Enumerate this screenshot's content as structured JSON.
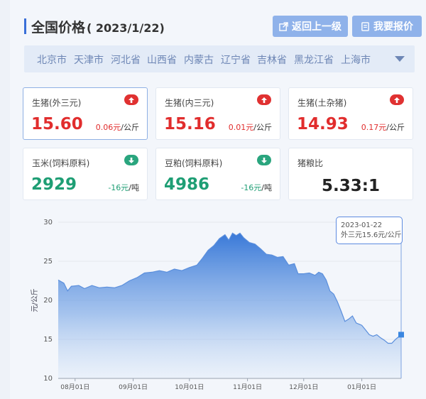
{
  "header": {
    "title": "全国价格",
    "date": "( 2023/1/22)",
    "back_label": "返回上一级",
    "quote_label": "我要报价"
  },
  "regions": [
    "北京市",
    "天津市",
    "河北省",
    "山西省",
    "内蒙古",
    "辽宁省",
    "吉林省",
    "黑龙江省",
    "上海市"
  ],
  "cards": [
    {
      "name": "生猪(外三元)",
      "price": "15.60",
      "change": "0.06元/公斤",
      "trend": "up"
    },
    {
      "name": "生猪(内三元)",
      "price": "15.16",
      "change": "0.01元/公斤",
      "trend": "up"
    },
    {
      "name": "生猪(土杂猪)",
      "price": "14.93",
      "change": "0.17元/公斤",
      "trend": "up"
    },
    {
      "name": "玉米(饲料原料)",
      "price": "2929",
      "change": "-16元/吨",
      "trend": "down"
    },
    {
      "name": "豆粕(饲料原料)",
      "price": "4986",
      "change": "-16元/吨",
      "trend": "down"
    },
    {
      "name": "猪粮比",
      "price": "5.33:1",
      "change": "",
      "trend": "none"
    }
  ],
  "colors": {
    "up": "#e12d2d",
    "down": "#1e9e74",
    "accent": "#3a6fd8",
    "line": "#4f86db"
  },
  "chart_data": {
    "type": "area",
    "ylabel": "元/公斤",
    "ylim": [
      10,
      30
    ],
    "yticks": [
      10,
      15,
      20,
      25,
      30
    ],
    "xtick_labels": [
      "08月01日",
      "09月01日",
      "10月01日",
      "11月01日",
      "12月01日",
      "01月01日"
    ],
    "xtick_dates": [
      "2022-08-01",
      "2022-09-01",
      "2022-10-01",
      "2022-11-01",
      "2022-12-01",
      "2023-01-01"
    ],
    "x_range": [
      "2022-07-23",
      "2023-01-22"
    ],
    "points": [
      [
        "2022-07-23",
        22.6
      ],
      [
        "2022-07-26",
        22.2
      ],
      [
        "2022-07-28",
        21.2
      ],
      [
        "2022-07-30",
        21.8
      ],
      [
        "2022-08-03",
        21.9
      ],
      [
        "2022-08-06",
        21.5
      ],
      [
        "2022-08-10",
        21.9
      ],
      [
        "2022-08-14",
        21.6
      ],
      [
        "2022-08-18",
        21.7
      ],
      [
        "2022-08-22",
        21.6
      ],
      [
        "2022-08-26",
        21.9
      ],
      [
        "2022-08-30",
        22.5
      ],
      [
        "2022-09-03",
        22.9
      ],
      [
        "2022-09-07",
        23.5
      ],
      [
        "2022-09-11",
        23.6
      ],
      [
        "2022-09-15",
        23.8
      ],
      [
        "2022-09-19",
        23.6
      ],
      [
        "2022-09-23",
        24.0
      ],
      [
        "2022-09-27",
        23.8
      ],
      [
        "2022-10-01",
        24.2
      ],
      [
        "2022-10-05",
        24.5
      ],
      [
        "2022-10-08",
        25.4
      ],
      [
        "2022-10-11",
        26.4
      ],
      [
        "2022-10-14",
        27.0
      ],
      [
        "2022-10-17",
        27.9
      ],
      [
        "2022-10-20",
        28.4
      ],
      [
        "2022-10-22",
        27.7
      ],
      [
        "2022-10-24",
        28.6
      ],
      [
        "2022-10-26",
        28.3
      ],
      [
        "2022-10-28",
        28.6
      ],
      [
        "2022-10-30",
        28.0
      ],
      [
        "2022-11-02",
        27.4
      ],
      [
        "2022-11-05",
        27.2
      ],
      [
        "2022-11-08",
        26.6
      ],
      [
        "2022-11-11",
        25.9
      ],
      [
        "2022-11-14",
        25.8
      ],
      [
        "2022-11-17",
        25.5
      ],
      [
        "2022-11-20",
        25.6
      ],
      [
        "2022-11-23",
        24.5
      ],
      [
        "2022-11-26",
        24.7
      ],
      [
        "2022-11-28",
        23.4
      ],
      [
        "2022-12-01",
        23.4
      ],
      [
        "2022-12-04",
        23.5
      ],
      [
        "2022-12-07",
        23.2
      ],
      [
        "2022-12-09",
        23.6
      ],
      [
        "2022-12-11",
        23.4
      ],
      [
        "2022-12-13",
        22.6
      ],
      [
        "2022-12-15",
        21.2
      ],
      [
        "2022-12-17",
        20.8
      ],
      [
        "2022-12-19",
        19.8
      ],
      [
        "2022-12-21",
        18.6
      ],
      [
        "2022-12-23",
        17.3
      ],
      [
        "2022-12-25",
        17.6
      ],
      [
        "2022-12-27",
        18.0
      ],
      [
        "2022-12-29",
        17.1
      ],
      [
        "2023-01-01",
        16.8
      ],
      [
        "2023-01-03",
        16.2
      ],
      [
        "2023-01-05",
        15.6
      ],
      [
        "2023-01-07",
        15.4
      ],
      [
        "2023-01-09",
        15.6
      ],
      [
        "2023-01-11",
        15.2
      ],
      [
        "2023-01-13",
        14.9
      ],
      [
        "2023-01-15",
        14.5
      ],
      [
        "2023-01-17",
        14.5
      ],
      [
        "2023-01-19",
        15.0
      ],
      [
        "2023-01-22",
        15.6
      ]
    ],
    "tooltip": {
      "date": "2023-01-22",
      "text": "外三元15.6元/公斤"
    }
  }
}
